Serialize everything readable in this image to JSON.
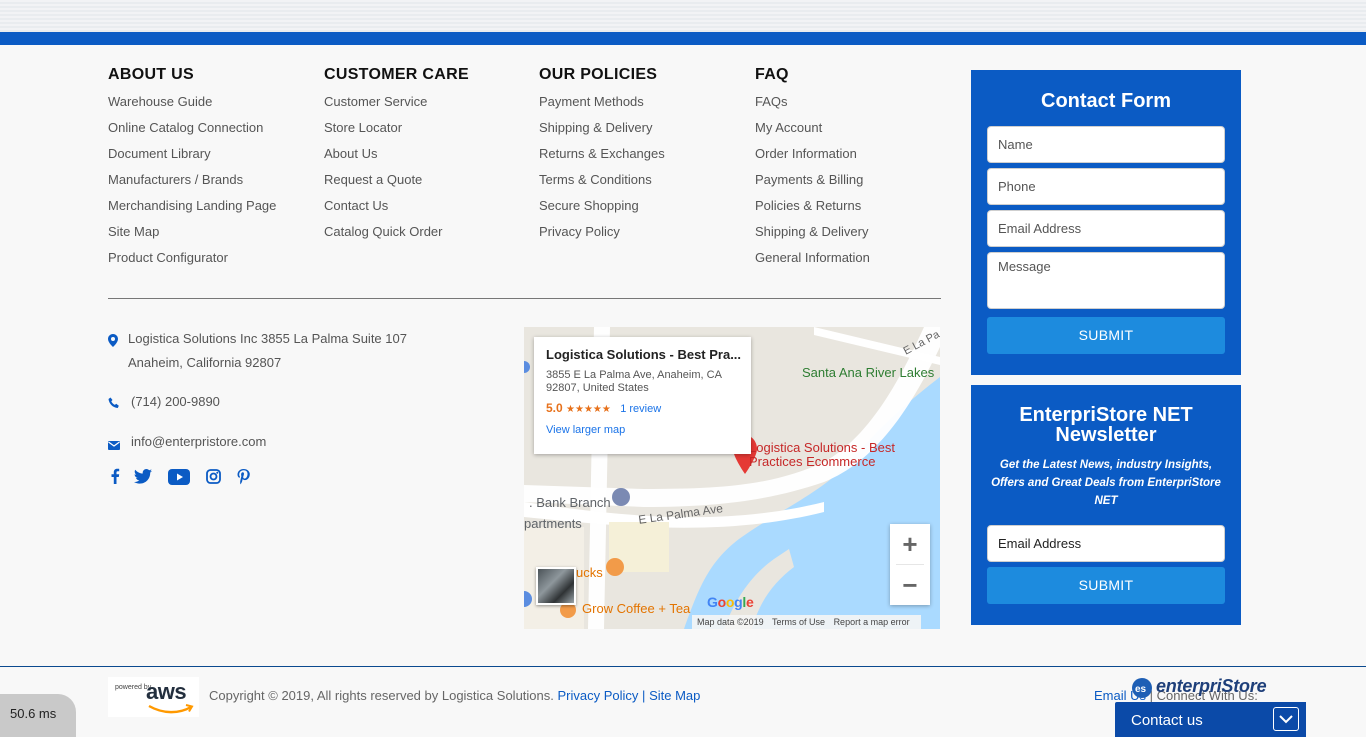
{
  "columns": [
    {
      "title": "ABOUT US",
      "items": [
        "Warehouse Guide",
        "Online Catalog Connection",
        "Document Library",
        "Manufacturers / Brands",
        "Merchandising Landing Page",
        "Site Map",
        "Product Configurator"
      ]
    },
    {
      "title": "CUSTOMER CARE",
      "items": [
        "Customer Service",
        "Store Locator",
        "About Us",
        "Request a Quote",
        "Contact Us",
        "Catalog Quick Order"
      ]
    },
    {
      "title": "OUR POLICIES",
      "items": [
        "Payment Methods",
        "Shipping & Delivery",
        "Returns & Exchanges",
        "Terms & Conditions",
        "Secure Shopping",
        "Privacy Policy"
      ]
    },
    {
      "title": "FAQ",
      "items": [
        "FAQs",
        "My Account",
        "Order Information",
        "Payments & Billing",
        "Policies & Returns",
        "Shipping & Delivery",
        "General Information"
      ]
    }
  ],
  "contact_info": {
    "address_line1": "Logistica Solutions Inc 3855 La Palma Suite 107",
    "address_line2": "Anaheim, California 92807",
    "phone": "(714) 200-9890",
    "email": "info@enterpristore.com",
    "social_icons": [
      "facebook-icon",
      "twitter-icon",
      "youtube-icon",
      "instagram-icon",
      "pinterest-icon"
    ]
  },
  "map": {
    "card_title": "Logistica Solutions - Best Pra...",
    "card_address_line1": "3855 E La Palma Ave, Anaheim, CA",
    "card_address_line2": "92807, United States",
    "rating": "5.0",
    "stars": "★★★★★",
    "reviews": "1 review",
    "larger_map": "View larger map",
    "pin_label_line1": "Logistica Solutions - Best",
    "pin_label_line2": "Practices Ecommerce",
    "label_river": "Santa Ana River Lakes",
    "label_bank": ". Bank Branch",
    "label_apartments": "partments",
    "label_street": "E La Palma Ave",
    "label_street_top": "E La Pa",
    "label_coffee": "Grow Coffee + Tea",
    "label_bucks": "ucks",
    "google": "Google",
    "attribution": [
      "Map data ©2019",
      "Terms of Use",
      "Report a map error"
    ],
    "zoom_in": "+",
    "zoom_out": "−"
  },
  "contact_form": {
    "title": "Contact Form",
    "name_placeholder": "Name",
    "phone_placeholder": "Phone",
    "email_placeholder": "Email Address",
    "message_placeholder": "Message",
    "submit": "SUBMIT"
  },
  "newsletter": {
    "title_line1": "EnterpriStore NET",
    "title_line2": "Newsletter",
    "subtitle": "Get the Latest News, industry Insights, Offers and Great Deals from EnterpriStore NET",
    "email_placeholder": "Email Address",
    "submit": "SUBMIT"
  },
  "footer": {
    "powered": "powered by",
    "aws": "aws",
    "copyright": "Copyright © 2019, All rights reserved by Logistica Solutions.",
    "privacy": "Privacy Policy",
    "separator": "|",
    "sitemap": "Site Map",
    "email_us": "Email Us",
    "connect": "Connect With Us:",
    "logo_text": "enterpriStore"
  },
  "timer": "50.6 ms",
  "contact_us_tab": "Contact us",
  "colors": {
    "brand_blue": "#0b5bc4",
    "button_blue": "#1d8bde",
    "map_water": "#aadaff"
  }
}
